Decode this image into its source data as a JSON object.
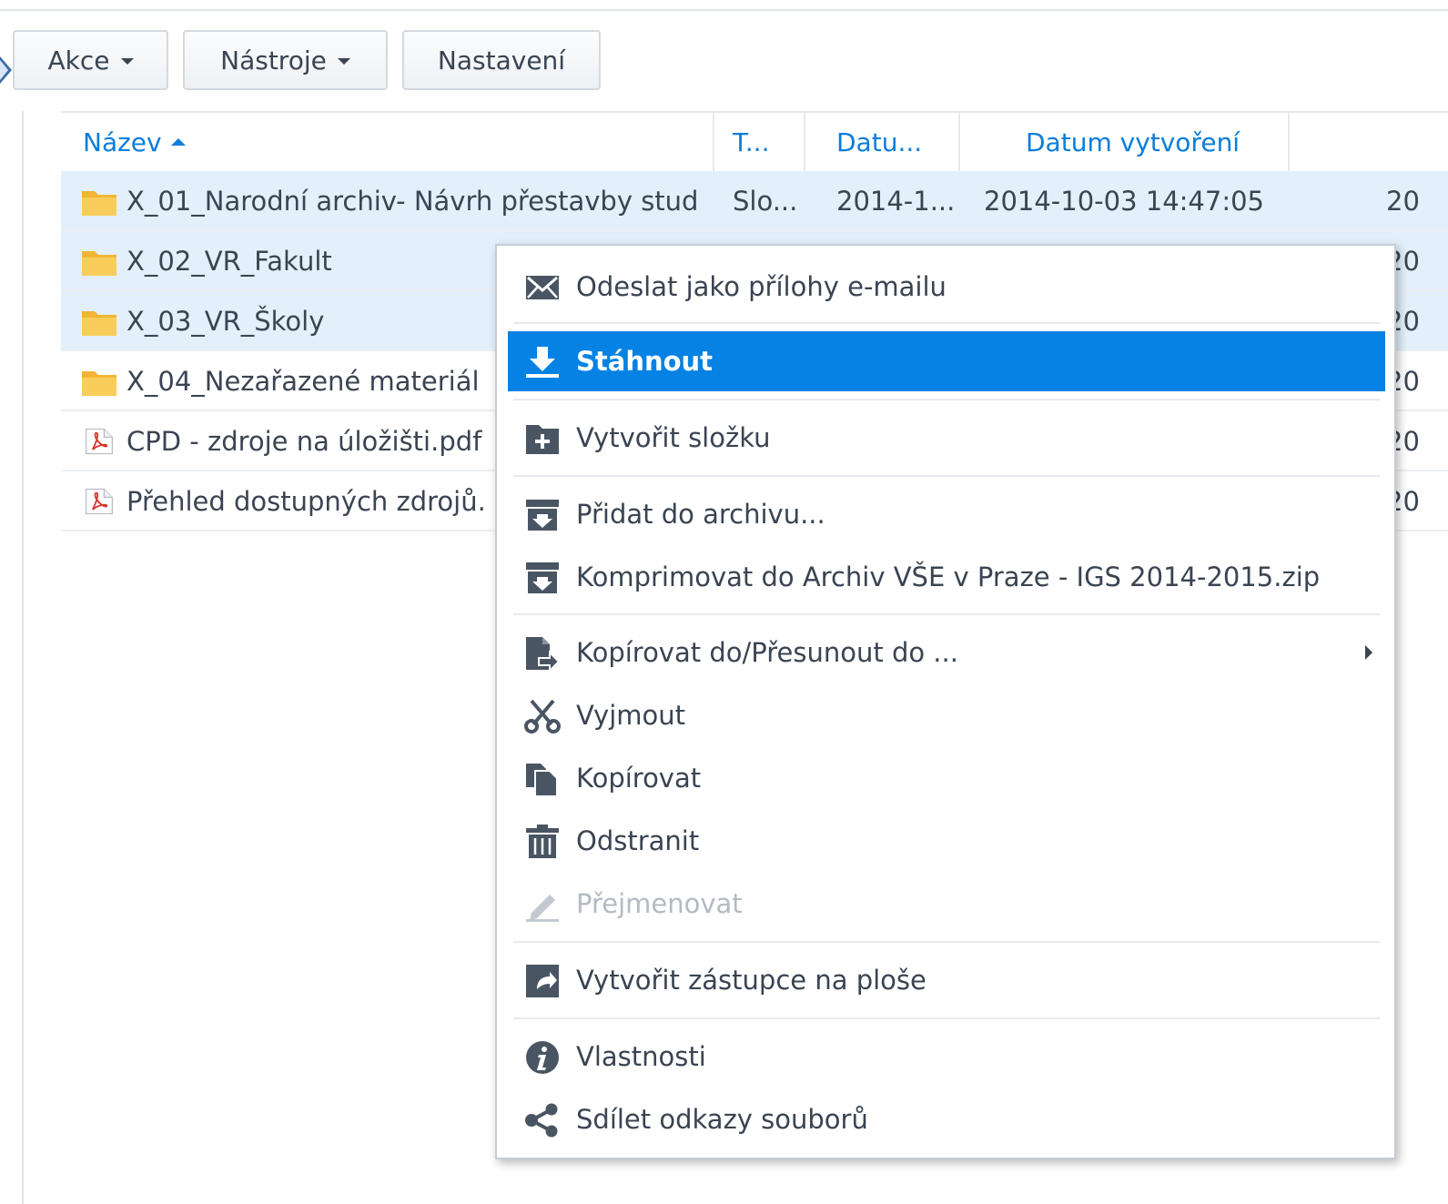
{
  "toolbar": {
    "action": "Akce",
    "tools": "Nástroje",
    "settings": "Nastavení"
  },
  "columns": {
    "name": "Název",
    "type": "T...",
    "modified": "Datu...",
    "created": "Datum vytvoření"
  },
  "rows": [
    {
      "name": "X_01_Narodní archiv- Návrh přestavby stud",
      "type": "Slo...",
      "modified": "2014-1...",
      "created": "2014-10-03 14:47:05",
      "extra": "20",
      "icon": "folder-icon",
      "selected": true
    },
    {
      "name": "X_02_VR_Fakult",
      "extra": "20",
      "icon": "folder-icon",
      "selected": true
    },
    {
      "name": "X_03_VR_Školy",
      "extra": "20",
      "icon": "folder-icon",
      "selected": true
    },
    {
      "name": "X_04_Nezařazené materiál",
      "extra": "20",
      "icon": "folder-icon",
      "selected": false
    },
    {
      "name": "CPD - zdroje na úložišti.pdf",
      "extra": "20",
      "icon": "pdf-icon",
      "selected": false
    },
    {
      "name": "Přehled dostupných zdrojů.",
      "extra": "20",
      "icon": "pdf-icon",
      "selected": false
    }
  ],
  "context_menu": {
    "items": [
      {
        "label": "Odeslat jako přílohy e-mailu",
        "icon": "email-icon"
      },
      {
        "label": "Stáhnout",
        "icon": "download-icon",
        "highlighted": true
      },
      {
        "label": "Vytvořit složku",
        "icon": "new-folder-icon"
      },
      {
        "label": "Přidat do archivu...",
        "icon": "archive-icon"
      },
      {
        "label": "Komprimovat do Archiv VŠE v Praze - IGS 2014-2015.zip",
        "icon": "archive-icon"
      },
      {
        "label": "Kopírovat do/Přesunout do ...",
        "icon": "copy-move-icon",
        "submenu": true
      },
      {
        "label": "Vyjmout",
        "icon": "scissors-icon"
      },
      {
        "label": "Kopírovat",
        "icon": "copy-icon"
      },
      {
        "label": "Odstranit",
        "icon": "trash-icon"
      },
      {
        "label": "Přejmenovat",
        "icon": "pencil-icon",
        "disabled": true
      },
      {
        "label": "Vytvořit zástupce na ploše",
        "icon": "shortcut-icon"
      },
      {
        "label": "Vlastnosti",
        "icon": "info-icon"
      },
      {
        "label": "Sdílet odkazy souborů",
        "icon": "share-icon"
      }
    ]
  },
  "colors": {
    "accent": "#0582e3",
    "header_text": "#0b7dda",
    "selected_row": "#e3effb",
    "folder": "#f7c54a"
  }
}
